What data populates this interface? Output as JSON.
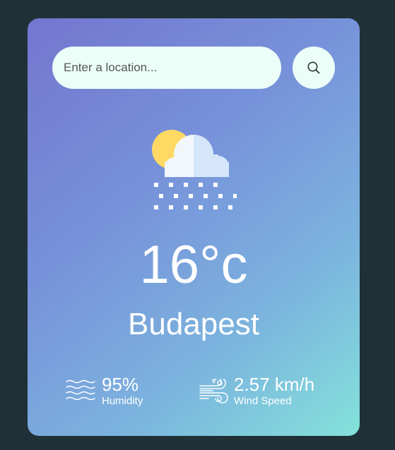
{
  "search": {
    "placeholder": "Enter a location...",
    "value": ""
  },
  "icons": {
    "search": "search-icon",
    "weather": "partly-cloudy-snow-icon",
    "humidity": "waves-icon",
    "wind": "wind-icon"
  },
  "weather": {
    "temperature": "16°c",
    "city": "Budapest"
  },
  "details": {
    "humidity_value": "95%",
    "humidity_label": "Humidity",
    "wind_value": "2.57 km/h",
    "wind_label": "Wind Speed"
  },
  "colors": {
    "background": "#1f3137",
    "gradient_start": "#7376cf",
    "gradient_end": "#83e2da",
    "input_bg": "#ebfff8",
    "text": "#ffffff"
  }
}
